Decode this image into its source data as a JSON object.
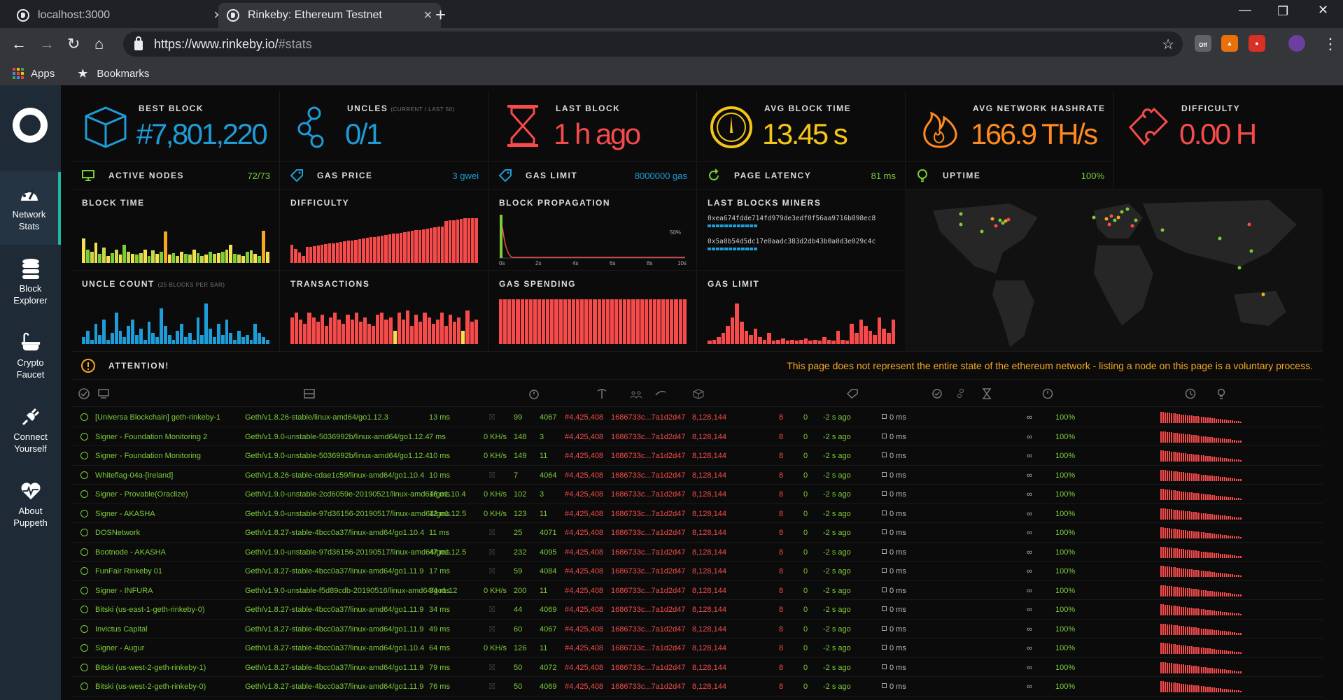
{
  "browser": {
    "tabs": [
      {
        "title": "localhost:3000",
        "active": false
      },
      {
        "title": "Rinkeby: Ethereum Testnet",
        "active": true
      }
    ],
    "url_main": "https://www.rinkeby.io/",
    "url_rest": "#stats",
    "bookmarks": {
      "apps": "Apps",
      "bookmarks": "Bookmarks"
    },
    "ext_off_label": "Off"
  },
  "sidebar": {
    "items": [
      {
        "line1": "Network",
        "line2": "Stats",
        "icon": "gauge-icon",
        "active": true
      },
      {
        "line1": "Block",
        "line2": "Explorer",
        "icon": "database-icon",
        "active": false
      },
      {
        "line1": "Crypto",
        "line2": "Faucet",
        "icon": "bathtub-icon",
        "active": false
      },
      {
        "line1": "Connect",
        "line2": "Yourself",
        "icon": "plug-icon",
        "active": false
      },
      {
        "line1": "About",
        "line2": "Puppeth",
        "icon": "heartbeat-icon",
        "active": false
      }
    ]
  },
  "stats": [
    {
      "label": "BEST BLOCK",
      "sub": "",
      "value": "#7,801,220",
      "color": "#1e9cd7",
      "icon": "cube-icon"
    },
    {
      "label": "UNCLES",
      "sub": "(CURRENT / LAST 50)",
      "value": "0/1",
      "color": "#1e9cd7",
      "icon": "uncles-icon"
    },
    {
      "label": "LAST BLOCK",
      "sub": "",
      "value": "1 h ago",
      "color": "#f74b4b",
      "icon": "hourglass-icon"
    },
    {
      "label": "AVG BLOCK TIME",
      "sub": "",
      "value": "13.45 s",
      "color": "#f5c518",
      "icon": "speedometer-icon"
    },
    {
      "label": "AVG NETWORK HASHRATE",
      "sub": "",
      "value": "166.9 TH/s",
      "color": "#ff8a1e",
      "icon": "flame-icon"
    },
    {
      "label": "DIFFICULTY",
      "sub": "",
      "value": "0.00 H",
      "color": "#f74b4b",
      "icon": "puzzle-icon"
    }
  ],
  "minis": [
    {
      "label": "ACTIVE NODES",
      "value": "72/73",
      "color": "#7bcc3a",
      "icon": "monitor-icon"
    },
    {
      "label": "GAS PRICE",
      "value": "3 gwei",
      "color": "#1e9cd7",
      "icon": "tag-icon"
    },
    {
      "label": "GAS LIMIT",
      "value": "8000000 gas",
      "color": "#1e9cd7",
      "icon": "tag-icon"
    },
    {
      "label": "PAGE LATENCY",
      "value": "81 ms",
      "color": "#7bcc3a",
      "icon": "refresh-icon"
    },
    {
      "label": "UPTIME",
      "value": "100%",
      "color": "#7bcc3a",
      "icon": "bulb-icon"
    }
  ],
  "charts": {
    "block_time": "BLOCK TIME",
    "difficulty": "DIFFICULTY",
    "block_propagation": "BLOCK PROPAGATION",
    "last_blocks_miners": "LAST BLOCKS MINERS",
    "uncle_count": "UNCLE COUNT",
    "uncle_count_sub": "(25 BLOCKS PER BAR)",
    "transactions": "TRANSACTIONS",
    "gas_spending": "GAS SPENDING",
    "gas_limit": "GAS LIMIT",
    "propagation_ticks": [
      "0s",
      "2s",
      "4s",
      "6s",
      "8s",
      "10s"
    ],
    "propagation_pct": "50%"
  },
  "miners": [
    "0xea674fdde714fd979de3edf0f56aa9716b898ec8",
    "0x5a0b54d5dc17e0aadc383d2db43b0a0d3e029c4c"
  ],
  "attention": {
    "label": "ATTENTION!",
    "message": "This page does not represent the entire state of the ethereum network - listing a node on this page is a voluntary process."
  },
  "nodes": [
    {
      "name": "[Universa Blockchain] geth-rinkeby-1",
      "client": "Geth/v1.8.26-stable/linux-amd64/go1.12.3",
      "latency": "13 ms",
      "hash": "",
      "peers": "99",
      "pending": "4067",
      "block": "#4,425,408",
      "blockhash": "1686733c...7a1d2d47",
      "difficulty": "8,128,144",
      "txs": "8",
      "uncles": "0",
      "last": "-2 s ago",
      "prop": "0 ms",
      "avg": "∞",
      "uptime": "100%"
    },
    {
      "name": "Signer - Foundation Monitoring 2",
      "client": "Geth/v1.9.0-unstable-5036992b/linux-amd64/go1.12.4",
      "latency": "7 ms",
      "hash": "0 KH/s",
      "peers": "148",
      "pending": "3",
      "block": "#4,425,408",
      "blockhash": "1686733c...7a1d2d47",
      "difficulty": "8,128,144",
      "txs": "8",
      "uncles": "0",
      "last": "-2 s ago",
      "prop": "0 ms",
      "avg": "∞",
      "uptime": "100%"
    },
    {
      "name": "Signer - Foundation Monitoring",
      "client": "Geth/v1.9.0-unstable-5036992b/linux-amd64/go1.12.4",
      "latency": "10 ms",
      "hash": "0 KH/s",
      "peers": "149",
      "pending": "11",
      "block": "#4,425,408",
      "blockhash": "1686733c...7a1d2d47",
      "difficulty": "8,128,144",
      "txs": "8",
      "uncles": "0",
      "last": "-2 s ago",
      "prop": "0 ms",
      "avg": "∞",
      "uptime": "100%"
    },
    {
      "name": "Whiteflag-04a-[Ireland]",
      "client": "Geth/v1.8.26-stable-cdae1c59/linux-amd64/go1.10.4",
      "latency": "10 ms",
      "hash": "",
      "peers": "7",
      "pending": "4064",
      "block": "#4,425,408",
      "blockhash": "1686733c...7a1d2d47",
      "difficulty": "8,128,144",
      "txs": "8",
      "uncles": "0",
      "last": "-2 s ago",
      "prop": "0 ms",
      "avg": "∞",
      "uptime": "100%"
    },
    {
      "name": "Signer - Provable(Oraclize)",
      "client": "Geth/v1.9.0-unstable-2cd6059e-20190521/linux-amd64/go1.10.4",
      "latency": "16 ms",
      "hash": "0 KH/s",
      "peers": "102",
      "pending": "3",
      "block": "#4,425,408",
      "blockhash": "1686733c...7a1d2d47",
      "difficulty": "8,128,144",
      "txs": "8",
      "uncles": "0",
      "last": "-2 s ago",
      "prop": "0 ms",
      "avg": "∞",
      "uptime": "100%"
    },
    {
      "name": "Signer - AKASHA",
      "client": "Geth/v1.9.0-unstable-97d36156-20190517/linux-amd64/go1.12.5",
      "latency": "12 ms",
      "hash": "0 KH/s",
      "peers": "123",
      "pending": "11",
      "block": "#4,425,408",
      "blockhash": "1686733c...7a1d2d47",
      "difficulty": "8,128,144",
      "txs": "8",
      "uncles": "0",
      "last": "-2 s ago",
      "prop": "0 ms",
      "avg": "∞",
      "uptime": "100%"
    },
    {
      "name": "DOSNetwork",
      "client": "Geth/v1.8.27-stable-4bcc0a37/linux-amd64/go1.10.4",
      "latency": "11 ms",
      "hash": "",
      "peers": "25",
      "pending": "4071",
      "block": "#4,425,408",
      "blockhash": "1686733c...7a1d2d47",
      "difficulty": "8,128,144",
      "txs": "8",
      "uncles": "0",
      "last": "-2 s ago",
      "prop": "0 ms",
      "avg": "∞",
      "uptime": "100%"
    },
    {
      "name": "Bootnode - AKASHA",
      "client": "Geth/v1.9.0-unstable-97d36156-20190517/linux-amd64/go1.12.5",
      "latency": "47 ms",
      "hash": "",
      "peers": "232",
      "pending": "4095",
      "block": "#4,425,408",
      "blockhash": "1686733c...7a1d2d47",
      "difficulty": "8,128,144",
      "txs": "8",
      "uncles": "0",
      "last": "-2 s ago",
      "prop": "0 ms",
      "avg": "∞",
      "uptime": "100%"
    },
    {
      "name": "FunFair Rinkeby 01",
      "client": "Geth/v1.8.27-stable-4bcc0a37/linux-amd64/go1.11.9",
      "latency": "17 ms",
      "hash": "",
      "peers": "59",
      "pending": "4084",
      "block": "#4,425,408",
      "blockhash": "1686733c...7a1d2d47",
      "difficulty": "8,128,144",
      "txs": "8",
      "uncles": "0",
      "last": "-2 s ago",
      "prop": "0 ms",
      "avg": "∞",
      "uptime": "100%"
    },
    {
      "name": "Signer - INFURA",
      "client": "Geth/v1.9.0-unstable-f5d89cdb-20190516/linux-amd64/go1.12",
      "latency": "34 ms",
      "hash": "0 KH/s",
      "peers": "200",
      "pending": "11",
      "block": "#4,425,408",
      "blockhash": "1686733c...7a1d2d47",
      "difficulty": "8,128,144",
      "txs": "8",
      "uncles": "0",
      "last": "-2 s ago",
      "prop": "0 ms",
      "avg": "∞",
      "uptime": "100%"
    },
    {
      "name": "Bitski (us-east-1-geth-rinkeby-0)",
      "client": "Geth/v1.8.27-stable-4bcc0a37/linux-amd64/go1.11.9",
      "latency": "34 ms",
      "hash": "",
      "peers": "44",
      "pending": "4069",
      "block": "#4,425,408",
      "blockhash": "1686733c...7a1d2d47",
      "difficulty": "8,128,144",
      "txs": "8",
      "uncles": "0",
      "last": "-2 s ago",
      "prop": "0 ms",
      "avg": "∞",
      "uptime": "100%"
    },
    {
      "name": "Invictus Capital",
      "client": "Geth/v1.8.27-stable-4bcc0a37/linux-amd64/go1.11.9",
      "latency": "49 ms",
      "hash": "",
      "peers": "60",
      "pending": "4067",
      "block": "#4,425,408",
      "blockhash": "1686733c...7a1d2d47",
      "difficulty": "8,128,144",
      "txs": "8",
      "uncles": "0",
      "last": "-2 s ago",
      "prop": "0 ms",
      "avg": "∞",
      "uptime": "100%"
    },
    {
      "name": "Signer - Augur",
      "client": "Geth/v1.8.27-stable-4bcc0a37/linux-amd64/go1.10.4",
      "latency": "64 ms",
      "hash": "0 KH/s",
      "peers": "126",
      "pending": "11",
      "block": "#4,425,408",
      "blockhash": "1686733c...7a1d2d47",
      "difficulty": "8,128,144",
      "txs": "8",
      "uncles": "0",
      "last": "-2 s ago",
      "prop": "0 ms",
      "avg": "∞",
      "uptime": "100%"
    },
    {
      "name": "Bitski (us-west-2-geth-rinkeby-1)",
      "client": "Geth/v1.8.27-stable-4bcc0a37/linux-amd64/go1.11.9",
      "latency": "79 ms",
      "hash": "",
      "peers": "50",
      "pending": "4072",
      "block": "#4,425,408",
      "blockhash": "1686733c...7a1d2d47",
      "difficulty": "8,128,144",
      "txs": "8",
      "uncles": "0",
      "last": "-2 s ago",
      "prop": "0 ms",
      "avg": "∞",
      "uptime": "100%"
    },
    {
      "name": "Bitski (us-west-2-geth-rinkeby-0)",
      "client": "Geth/v1.8.27-stable-4bcc0a37/linux-amd64/go1.11.9",
      "latency": "76 ms",
      "hash": "",
      "peers": "50",
      "pending": "4069",
      "block": "#4,425,408",
      "blockhash": "1686733c...7a1d2d47",
      "difficulty": "8,128,144",
      "txs": "8",
      "uncles": "0",
      "last": "-2 s ago",
      "prop": "0 ms",
      "avg": "∞",
      "uptime": "100%"
    }
  ]
}
